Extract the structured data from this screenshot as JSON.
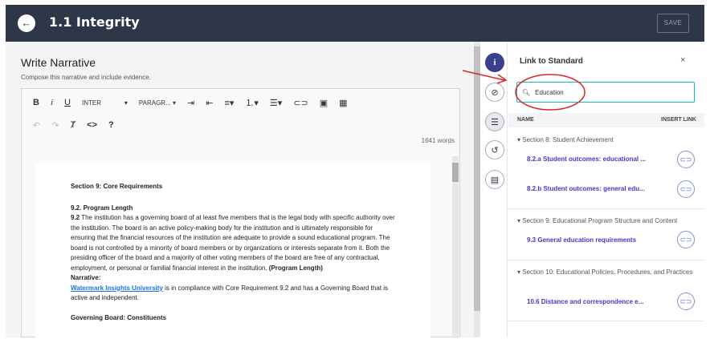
{
  "header": {
    "back_icon": "arrow-left-icon",
    "title": "1.1 Integrity",
    "save_label": "SAVE"
  },
  "narrative": {
    "title": "Write Narrative",
    "subtitle": "Compose this narrative and include evidence.",
    "toolbar": {
      "bold": "B",
      "italic": "i",
      "underline": "U",
      "font": "INTER",
      "paragraph": "PARAGR...",
      "code": "<>",
      "help": "?"
    },
    "word_count": "1641 words",
    "document": {
      "heading1": "Section 9: Core Requirements",
      "heading2": "9.2. Program Length",
      "para_prefix": "9.2",
      "para_body": " The institution has a governing board of at least five members that is the legal body with specific authority over the institution. The board is an active policy-making body for the institution and is ultimately responsible for ensuring that the financial resources of the institution are adequate to provide a sound educational program. The board is not controlled by a minority of board members or by organizations or interests separate from it. Both the presiding officer of the board and a majority of other voting members of the board are free of any contractual, employment, or personal or familial financial interest in the institution.",
      "para_suffix": "(Program Length)",
      "narrative_label": "Narrative:",
      "link_text": "Watermark Insights University",
      "compliance_text": " is in compliance with Core Requirement 9.2 and has a Governing Board that is active and independent.",
      "heading3": "Governing Board: Constituents"
    }
  },
  "panel": {
    "title": "Link to Standard",
    "close": "×",
    "search_value": "Education",
    "col_name": "NAME",
    "col_insert": "INSERT LINK",
    "sections": [
      {
        "label": "Section 8: Student Achievement",
        "items": [
          "8.2.a Student outcomes: educational ...",
          "8.2.b Student outcomes: general edu..."
        ]
      },
      {
        "label": "Section 9: Educational Program Structure and Content",
        "items": [
          "9.3 General education requirements"
        ]
      },
      {
        "label": "Section 10: Educational Policies, Procedures, and Practices",
        "items": [
          "10.6 Distance and correspondence e..."
        ]
      }
    ]
  },
  "annotation_color": "#dc2626"
}
